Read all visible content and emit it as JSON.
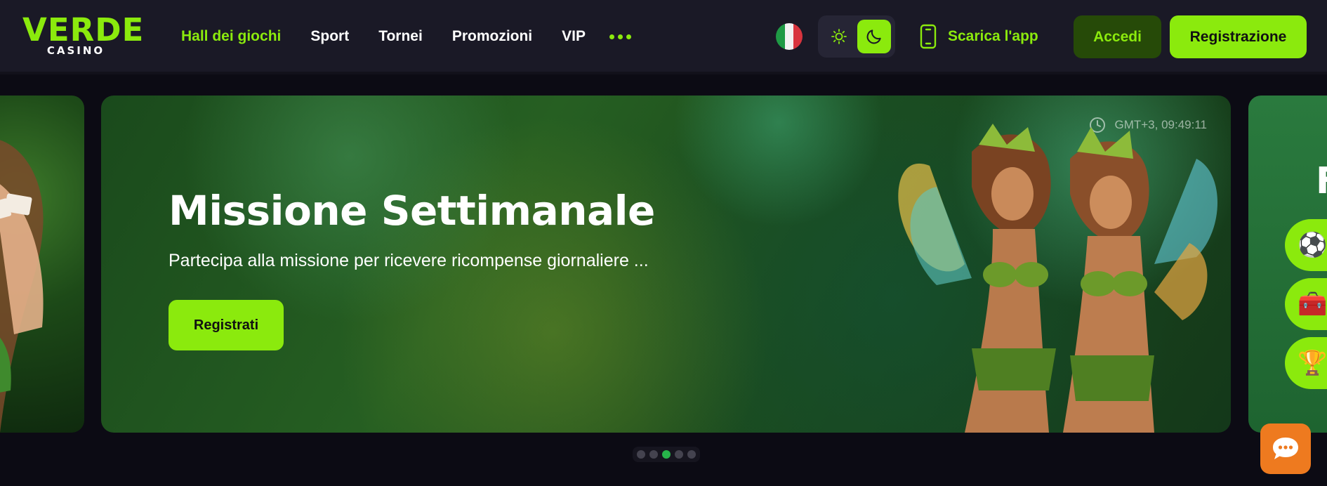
{
  "brand": {
    "name": "VERDE",
    "tagline": "CASINO",
    "accent": "#8bea0d"
  },
  "nav": {
    "items": [
      {
        "label": "Hall dei giochi",
        "active": true
      },
      {
        "label": "Sport",
        "active": false
      },
      {
        "label": "Tornei",
        "active": false
      },
      {
        "label": "Promozioni",
        "active": false
      },
      {
        "label": "VIP",
        "active": false
      }
    ],
    "more_icon": "ellipsis-icon"
  },
  "language": {
    "flag": "italy-flag-icon"
  },
  "theme": {
    "light_icon": "sun-icon",
    "dark_icon": "moon-icon",
    "selected": "dark"
  },
  "app_download": {
    "label": "Scarica l'app",
    "icon": "smartphone-icon"
  },
  "auth": {
    "login_label": "Accedi",
    "register_label": "Registrazione"
  },
  "banner": {
    "time_icon": "clock-icon",
    "time": "GMT+3,  09:49:11",
    "title": "Missione Settimanale",
    "subtitle": "Partecipa alla missione per ricevere ricompense giornaliere ...",
    "cta_label": "Registrati"
  },
  "next_slide": {
    "letter": "F",
    "pills": [
      "soccer-ball-icon",
      "treasure-chest-icon",
      "trophy-icon"
    ]
  },
  "pagination": {
    "count": 5,
    "active_index": 2
  },
  "chat": {
    "icon": "chat-bubble-icon",
    "color": "#ee7a1f"
  }
}
